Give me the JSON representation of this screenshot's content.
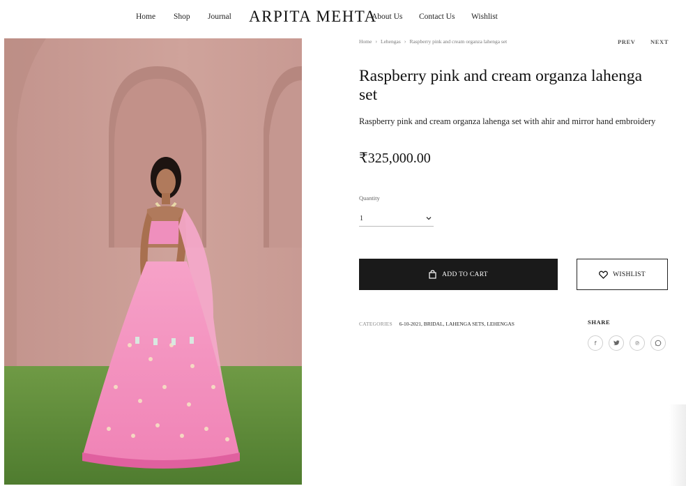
{
  "nav": {
    "home": "Home",
    "shop": "Shop",
    "journal": "Journal",
    "logo": "ARPITA MEHTA",
    "about": "About Us",
    "contact": "Contact Us",
    "wishlist": "Wishlist"
  },
  "breadcrumb": {
    "home": "Home",
    "category": "Lehengas",
    "current": "Raspberry pink and cream organza lahenga set"
  },
  "pager": {
    "prev": "PREV",
    "next": "NEXT"
  },
  "product": {
    "title": "Raspberry pink and cream organza lahenga set",
    "description": "Raspberry pink and cream organza lahenga set with ahir and mirror hand embroidery",
    "price": "₹325,000.00"
  },
  "quantity": {
    "label": "Quantity",
    "value": "1"
  },
  "actions": {
    "add_to_cart": "ADD TO CART",
    "wishlist": "WISHLIST"
  },
  "categories": {
    "label": "CATEGORIES",
    "links": "6-10-2021, BRIDAL, LAHENGA SETS, LEHENGAS"
  },
  "share": {
    "title": "SHARE",
    "icons": [
      "facebook-icon",
      "twitter-icon",
      "pinterest-icon",
      "whatsapp-icon"
    ]
  },
  "colors": {
    "button_dark": "#1a1a1a",
    "wall_pink": "#c99c95",
    "lehenga_pink": "#f58fc0",
    "grass_green": "#5f8c3a"
  }
}
